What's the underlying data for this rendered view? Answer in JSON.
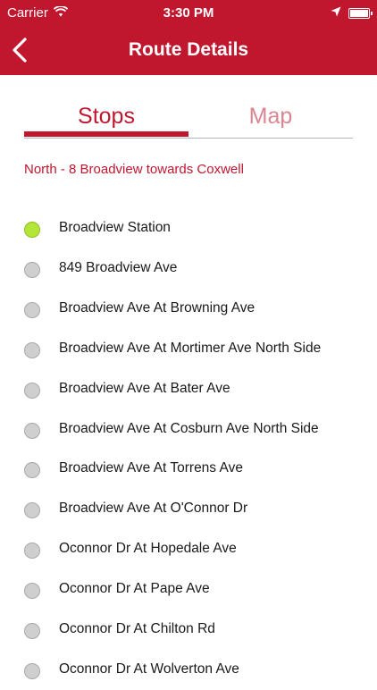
{
  "status_bar": {
    "carrier": "Carrier",
    "time": "3:30 PM"
  },
  "nav": {
    "title": "Route Details"
  },
  "tabs": [
    {
      "label": "Stops",
      "selected": true
    },
    {
      "label": "Map",
      "selected": false
    }
  ],
  "route": {
    "label": "North - 8 Broadview towards Coxwell"
  },
  "stops": [
    {
      "name": "Broadview Station",
      "active": true
    },
    {
      "name": "849 Broadview Ave",
      "active": false
    },
    {
      "name": "Broadview Ave At Browning Ave",
      "active": false
    },
    {
      "name": "Broadview Ave At Mortimer Ave North Side",
      "active": false
    },
    {
      "name": "Broadview Ave At Bater Ave",
      "active": false
    },
    {
      "name": "Broadview Ave At Cosburn Ave North Side",
      "active": false
    },
    {
      "name": "Broadview Ave At Torrens Ave",
      "active": false
    },
    {
      "name": "Broadview Ave At O'Connor Dr",
      "active": false
    },
    {
      "name": "Oconnor Dr At Hopedale Ave",
      "active": false
    },
    {
      "name": "Oconnor Dr At Pape Ave",
      "active": false
    },
    {
      "name": "Oconnor Dr At Chilton Rd",
      "active": false
    },
    {
      "name": "Oconnor Dr At Wolverton Ave",
      "active": false
    }
  ],
  "colors": {
    "brand": "#c0172f",
    "tab_inactive": "#dc8592",
    "active_stop": "#b4e63a",
    "inactive_stop": "#cfcfcf"
  },
  "icons": {
    "wifi": "wifi-icon",
    "location": "location-arrow-icon",
    "battery": "battery-icon",
    "back": "chevron-left-icon"
  }
}
